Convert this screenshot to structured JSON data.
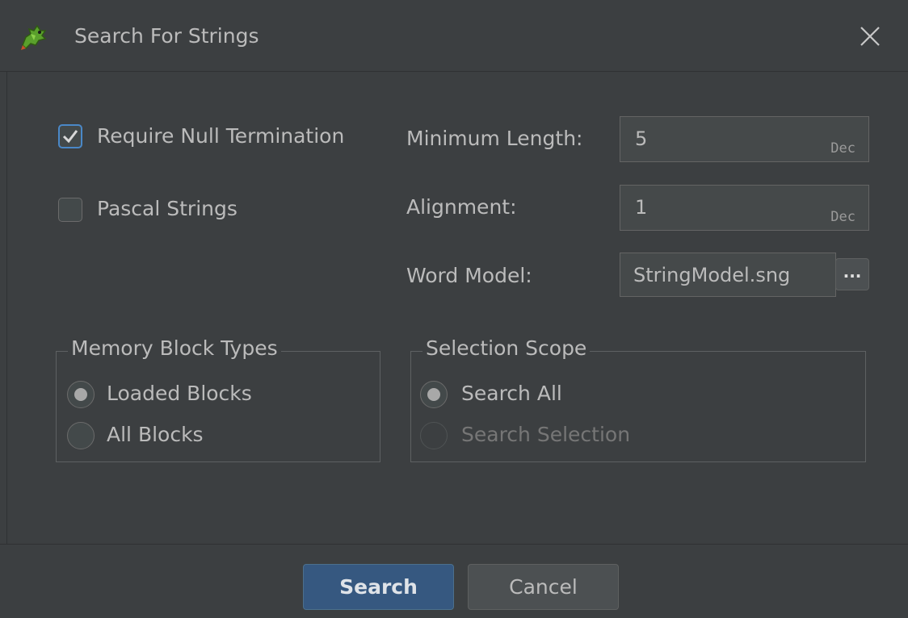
{
  "window": {
    "title": "Search For Strings",
    "icon": "dragon-icon",
    "close_icon": "close-icon"
  },
  "options": {
    "null_termination": {
      "label": "Require Null Termination",
      "checked": true
    },
    "pascal_strings": {
      "label": "Pascal Strings",
      "checked": false
    }
  },
  "fields": {
    "min_length": {
      "label": "Minimum Length:",
      "value": "5",
      "format": "Dec"
    },
    "alignment": {
      "label": "Alignment:",
      "value": "1",
      "format": "Dec"
    },
    "word_model": {
      "label": "Word Model:",
      "value": "StringModel.sng",
      "browse_label": "..."
    }
  },
  "memory_block_types": {
    "title": "Memory Block Types",
    "options": [
      {
        "label": "Loaded Blocks",
        "selected": true
      },
      {
        "label": "All Blocks",
        "selected": false
      }
    ]
  },
  "selection_scope": {
    "title": "Selection Scope",
    "options": [
      {
        "label": "Search All",
        "selected": true,
        "enabled": true
      },
      {
        "label": "Search Selection",
        "selected": false,
        "enabled": false
      }
    ]
  },
  "buttons": {
    "search": "Search",
    "cancel": "Cancel"
  },
  "colors": {
    "background": "#3c3f41",
    "text": "#bbbbbb",
    "accent": "#4a88c7",
    "primary_button": "#365880",
    "field_background": "#45494a"
  }
}
